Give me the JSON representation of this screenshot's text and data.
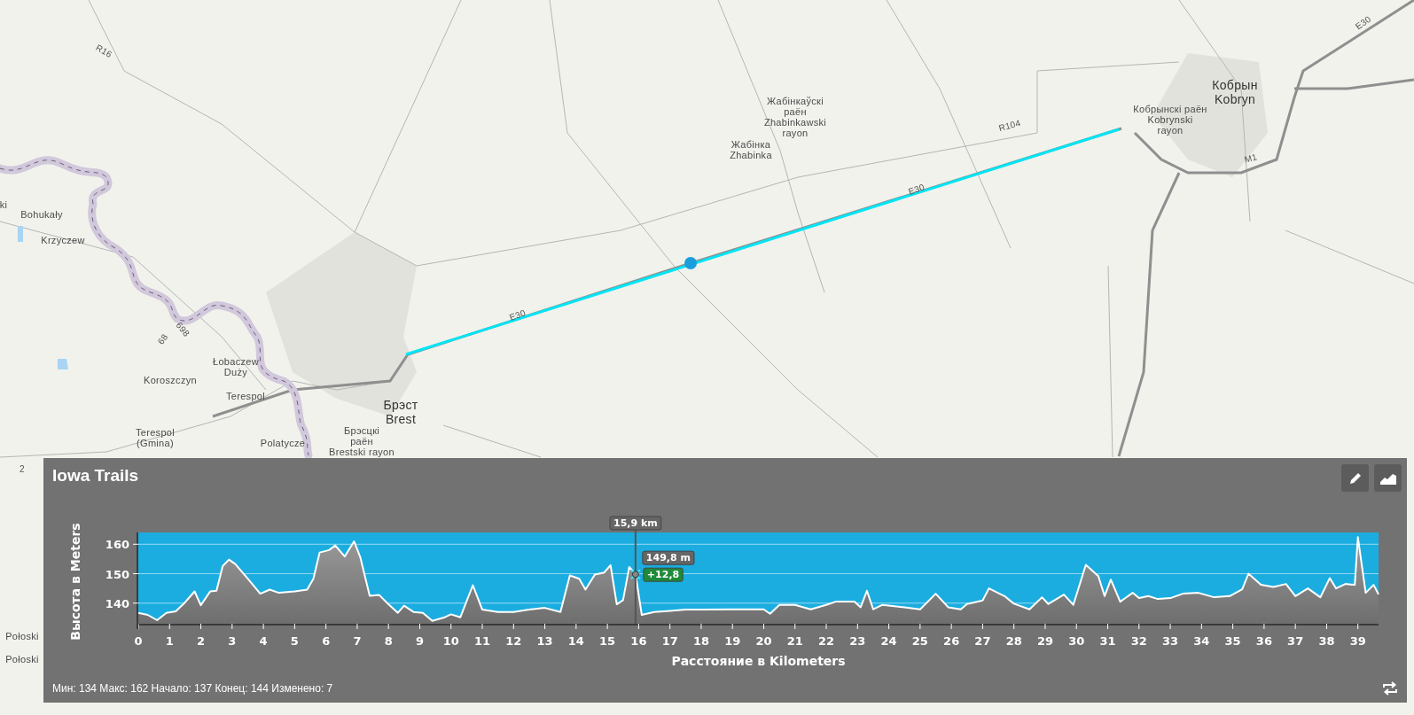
{
  "map": {
    "labels": [
      {
        "kind": "place",
        "lines": [
          "ki"
        ]
      },
      {
        "kind": "place",
        "lines": [
          "Bohukały"
        ]
      },
      {
        "kind": "place",
        "lines": [
          "Krzyczew"
        ]
      },
      {
        "kind": "place",
        "lines": [
          "Łobaczew",
          "Duży"
        ]
      },
      {
        "kind": "place",
        "lines": [
          "Koroszczyn"
        ]
      },
      {
        "kind": "place",
        "lines": [
          "Terespol"
        ]
      },
      {
        "kind": "place",
        "lines": [
          "Terespol",
          "(Gmina)"
        ]
      },
      {
        "kind": "place",
        "lines": [
          "Polatycze"
        ]
      },
      {
        "kind": "city",
        "lines": [
          "Брэст",
          "Brest"
        ]
      },
      {
        "kind": "place",
        "lines": [
          "Брэсцкі",
          "раён",
          "Brestski rayon"
        ]
      },
      {
        "kind": "place",
        "lines": [
          "Жабінкаўскі",
          "раён",
          "Zhabinkawski",
          "rayon"
        ]
      },
      {
        "kind": "place",
        "lines": [
          "Жабінка",
          "Zhabinka"
        ]
      },
      {
        "kind": "city",
        "lines": [
          "Кобрын",
          "Kobryn"
        ]
      },
      {
        "kind": "place",
        "lines": [
          "Кобрынскі раён",
          "Kobrynski",
          "rayon"
        ]
      },
      {
        "kind": "road",
        "lines": [
          "R16"
        ]
      },
      {
        "kind": "road",
        "lines": [
          "R104"
        ]
      },
      {
        "kind": "road",
        "lines": [
          "E30"
        ]
      },
      {
        "kind": "road",
        "lines": [
          "E30"
        ]
      },
      {
        "kind": "road",
        "lines": [
          "E30"
        ]
      },
      {
        "kind": "road",
        "lines": [
          "M1"
        ]
      },
      {
        "kind": "road",
        "lines": [
          "698"
        ]
      },
      {
        "kind": "road",
        "lines": [
          "68"
        ]
      },
      {
        "kind": "road",
        "lines": [
          "2"
        ]
      },
      {
        "kind": "place",
        "lines": [
          "Połoski"
        ]
      },
      {
        "kind": "place",
        "lines": [
          "Połoski"
        ]
      }
    ]
  },
  "profile": {
    "title": "Iowa Trails",
    "stats": "Мин: 134 Макс: 162 Начало: 137 Конец: 144 Изменено: 7",
    "chart_data": {
      "type": "area",
      "xlabel": "Расстояние в Kilometers",
      "ylabel": "Высота в Meters",
      "x": [
        0,
        0.3,
        0.6,
        0.9,
        1.2,
        1.5,
        1.8,
        2.0,
        2.3,
        2.5,
        2.7,
        2.9,
        3.1,
        3.5,
        3.9,
        4.2,
        4.5,
        5.0,
        5.4,
        5.6,
        5.8,
        6.1,
        6.3,
        6.6,
        6.9,
        7.1,
        7.4,
        7.7,
        8.0,
        8.3,
        8.5,
        8.8,
        9.1,
        9.4,
        9.8,
        10.0,
        10.3,
        10.7,
        11.0,
        11.5,
        12.0,
        12.5,
        13.0,
        13.5,
        13.8,
        14.1,
        14.3,
        14.6,
        14.9,
        15.1,
        15.3,
        15.5,
        15.7,
        15.9,
        16.1,
        16.5,
        17.0,
        17.5,
        18.0,
        19.0,
        19.5,
        20.0,
        20.2,
        20.5,
        21.0,
        21.5,
        22.0,
        22.3,
        22.9,
        23.1,
        23.3,
        23.5,
        23.8,
        24.5,
        25.0,
        25.5,
        25.9,
        26.3,
        26.5,
        27.0,
        27.2,
        27.7,
        28.0,
        28.5,
        28.9,
        29.1,
        29.6,
        29.9,
        30.3,
        30.7,
        30.9,
        31.1,
        31.4,
        31.8,
        32.0,
        32.3,
        32.6,
        33.0,
        33.4,
        33.9,
        34.4,
        34.9,
        35.3,
        35.5,
        35.9,
        36.3,
        36.7,
        37.0,
        37.4,
        37.8,
        38.1,
        38.3,
        38.6,
        38.9,
        39.0,
        39.25,
        39.5,
        39.66
      ],
      "series": [
        {
          "color": "#ffffff",
          "values": [
            136.7,
            136,
            134.2,
            136.7,
            137.2,
            140.3,
            144,
            139.3,
            144,
            144.2,
            152.6,
            154.8,
            153.3,
            148.3,
            143.2,
            144.6,
            143.5,
            144,
            144.6,
            148.3,
            157.2,
            158,
            159.6,
            155.8,
            161,
            155.5,
            142.5,
            142.8,
            139.6,
            136.7,
            139.1,
            137,
            136.7,
            134,
            135.2,
            136.2,
            135.2,
            146.1,
            137.8,
            137,
            137,
            137.8,
            138.4,
            137,
            149.4,
            148.3,
            144.6,
            149.7,
            150.4,
            152.9,
            139.6,
            141,
            152.3,
            149.8,
            136,
            137,
            137.4,
            137.8,
            137.8,
            137.9,
            137.9,
            137.9,
            136.4,
            139.4,
            139.4,
            137.9,
            139.4,
            140.5,
            140.5,
            138.6,
            144.2,
            137.9,
            139.4,
            138.6,
            137.9,
            143.2,
            138.6,
            137.9,
            139.7,
            140.9,
            145,
            142.4,
            139.8,
            137.9,
            142,
            139.7,
            142.9,
            139.4,
            153,
            149.2,
            142.4,
            148,
            140.5,
            143.5,
            141.7,
            142.4,
            141.4,
            141.7,
            143.2,
            143.5,
            142,
            142.4,
            144.7,
            150,
            146.2,
            145.5,
            146.5,
            142.4,
            145,
            142,
            148.5,
            145,
            146.5,
            146.2,
            162.4,
            143.5,
            146.2,
            143
          ]
        }
      ],
      "xlim": [
        0,
        39.66
      ],
      "ylim": [
        133,
        164
      ],
      "xticks": [
        0,
        1,
        2,
        3,
        4,
        5,
        6,
        7,
        8,
        9,
        10,
        11,
        12,
        13,
        14,
        15,
        16,
        17,
        18,
        19,
        20,
        21,
        22,
        23,
        24,
        25,
        26,
        27,
        28,
        29,
        30,
        31,
        32,
        33,
        34,
        35,
        36,
        37,
        38,
        39
      ],
      "yticks": [
        140,
        150,
        160
      ],
      "grid": true,
      "ref_lines": [
        {
          "axis": "x",
          "value": 15.9,
          "label": "15,9 km"
        }
      ],
      "annotations": [
        {
          "x": 15.9,
          "y": 149.8,
          "text": "149,8 m"
        },
        {
          "x": 15.9,
          "y": 149.8,
          "text": "+12,8"
        }
      ]
    }
  }
}
